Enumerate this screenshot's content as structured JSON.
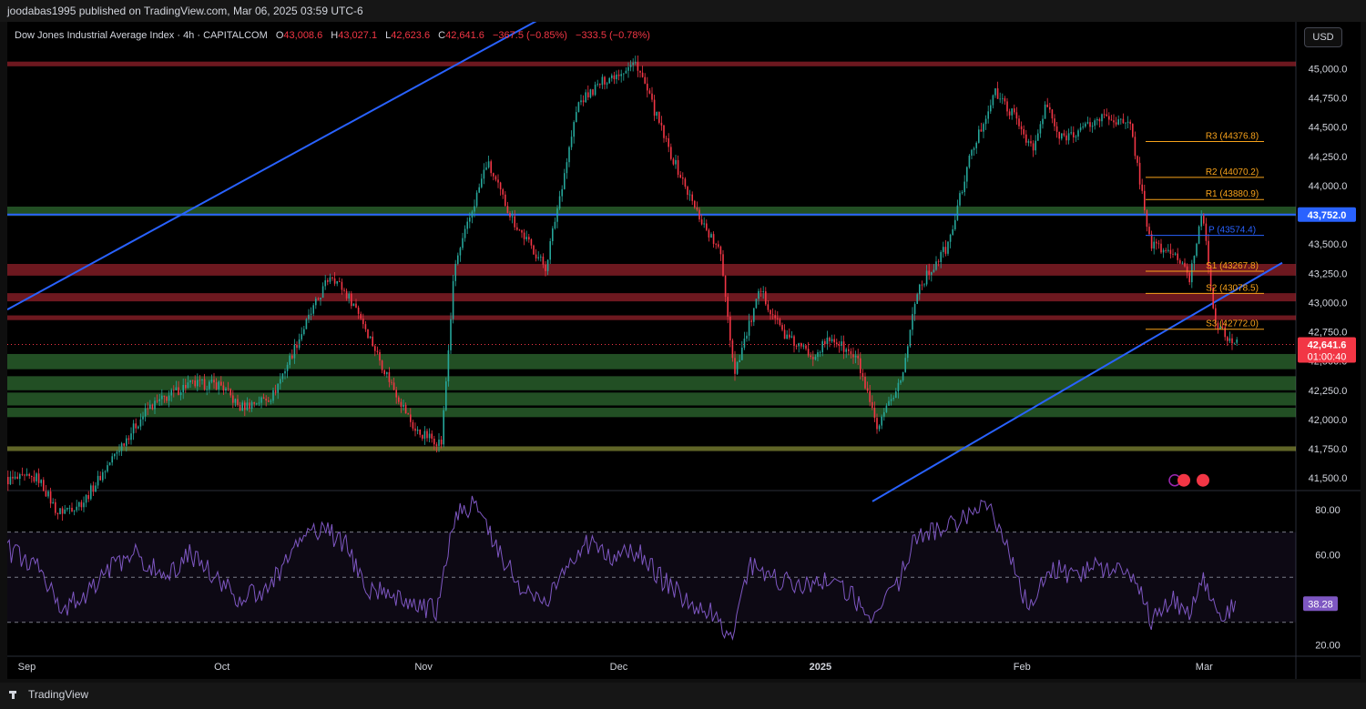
{
  "header": {
    "publisher": "joodabas1995 published on TradingView.com, Mar 06, 2025 03:59 UTC-6"
  },
  "legend": {
    "symbol": "Dow Jones Industrial Average Index · 4h · CAPITALCOM",
    "o_label": "O",
    "o_value": "43,008.6",
    "h_label": "H",
    "h_value": "43,027.1",
    "l_label": "L",
    "l_value": "42,623.6",
    "c_label": "C",
    "c_value": "42,641.6",
    "change": "−367.5 (−0.85%)",
    "change2": "−333.5 (−0.78%)"
  },
  "currency_button": "USD",
  "footer": {
    "brand": "TradingView"
  },
  "colors": {
    "background": "#000000",
    "bull": "#26a69a",
    "bear": "#f23645",
    "trendline": "#2962ff",
    "pivot_orange": "#f7a21b",
    "pivot_blue": "#2962ff",
    "rsi": "#7e57c2",
    "support_zone": "#4caf50",
    "resistance_zone": "#f23645",
    "major_support": "#d4e157"
  },
  "chart_data": [
    {
      "type": "candlestick",
      "title": "Dow Jones Industrial Average Index · 4h · CAPITALCOM",
      "x_ticks": [
        "Sep",
        "Oct",
        "Nov",
        "Dec",
        "2025",
        "Feb",
        "Mar"
      ],
      "ylim": [
        41400,
        45400
      ],
      "y_ticks": [
        "45,000.0",
        "44,750.0",
        "44,500.0",
        "44,250.0",
        "44,000.0",
        "43,750.0",
        "43,500.0",
        "43,250.0",
        "43,000.0",
        "42,750.0",
        "42,500.0",
        "42,250.0",
        "42,000.0",
        "41,750.0",
        "41,500.0"
      ],
      "y_tick_values": [
        45000,
        44750,
        44500,
        44250,
        44000,
        43750,
        43500,
        43250,
        43000,
        42750,
        42500,
        42250,
        42000,
        41750,
        41500
      ],
      "price_path": [
        [
          "Aug 29",
          41480
        ],
        [
          "Sep 3",
          41500
        ],
        [
          "Sep 6",
          41200
        ],
        [
          "Sep 10",
          41300
        ],
        [
          "Sep 16",
          41800
        ],
        [
          "Sep 20",
          42100
        ],
        [
          "Sep 26",
          42300
        ],
        [
          "Oct 1",
          42300
        ],
        [
          "Oct 4",
          42100
        ],
        [
          "Oct 9",
          42200
        ],
        [
          "Oct 14",
          42800
        ],
        [
          "Oct 18",
          43250
        ],
        [
          "Oct 22",
          42950
        ],
        [
          "Oct 26",
          42450
        ],
        [
          "Oct 31",
          41900
        ],
        [
          "Nov 4",
          41800
        ],
        [
          "Nov 6",
          43300
        ],
        [
          "Nov 11",
          44200
        ],
        [
          "Nov 15",
          43700
        ],
        [
          "Nov 20",
          43300
        ],
        [
          "Nov 25",
          44700
        ],
        [
          "Nov 29",
          44900
        ],
        [
          "Dec 4",
          45050
        ],
        [
          "Dec 9",
          44300
        ],
        [
          "Dec 13",
          43800
        ],
        [
          "Dec 17",
          43400
        ],
        [
          "Dec 19",
          42400
        ],
        [
          "Dec 23",
          43100
        ],
        [
          "Dec 27",
          42700
        ],
        [
          "Dec 31",
          42550
        ],
        [
          "Jan 3",
          42700
        ],
        [
          "Jan 7",
          42500
        ],
        [
          "Jan 10",
          41900
        ],
        [
          "Jan 14",
          42400
        ],
        [
          "Jan 16",
          43100
        ],
        [
          "Jan 21",
          43500
        ],
        [
          "Jan 24",
          44200
        ],
        [
          "Jan 28",
          44800
        ],
        [
          "Jan 31",
          44600
        ],
        [
          "Feb 3",
          44300
        ],
        [
          "Feb 5",
          44700
        ],
        [
          "Feb 7",
          44400
        ],
        [
          "Feb 11",
          44500
        ],
        [
          "Feb 14",
          44600
        ],
        [
          "Feb 18",
          44500
        ],
        [
          "Feb 21",
          43500
        ],
        [
          "Feb 25",
          43400
        ],
        [
          "Feb 27",
          43200
        ],
        [
          "Mar 1",
          43800
        ],
        [
          "Mar 3",
          42800
        ],
        [
          "Mar 5",
          42700
        ],
        [
          "Mar 6",
          42641.6
        ]
      ],
      "last_price": {
        "value": 42641.6,
        "label": "42,641.6",
        "countdown": "01:00:40"
      },
      "trendlines": [
        {
          "name": "upper-channel-line",
          "points": [
            [
              "Aug 29",
              42940
            ],
            [
              "Nov 28",
              45700
            ]
          ]
        },
        {
          "name": "lower-channel-line",
          "points": [
            [
              "Jan 9",
              41300
            ],
            [
              "Mar 13",
              43340
            ]
          ]
        }
      ],
      "horizontal_lines": [
        {
          "name": "blue-level",
          "value": 43752.0,
          "label": "43,752.0",
          "color": "#2962ff"
        }
      ],
      "zones": [
        {
          "name": "resistance-zone-top",
          "low": 45020,
          "high": 45060,
          "color": "#f23645"
        },
        {
          "name": "green-zone-43750",
          "low": 43740,
          "high": 43820,
          "color": "#4caf50"
        },
        {
          "name": "red-zone-43300",
          "low": 43230,
          "high": 43330,
          "color": "#f23645"
        },
        {
          "name": "red-zone-43050",
          "low": 43010,
          "high": 43080,
          "color": "#f23645"
        },
        {
          "name": "red-zone-42870",
          "low": 42850,
          "high": 42890,
          "color": "#f23645"
        },
        {
          "name": "green-zone-42500",
          "low": 42430,
          "high": 42560,
          "color": "#4caf50"
        },
        {
          "name": "green-zone-42300",
          "low": 42250,
          "high": 42370,
          "color": "#4caf50"
        },
        {
          "name": "green-zone-42150",
          "low": 42120,
          "high": 42230,
          "color": "#4caf50"
        },
        {
          "name": "green-zone-42050",
          "low": 42020,
          "high": 42100,
          "color": "#4caf50"
        },
        {
          "name": "major-support-41750",
          "low": 41730,
          "high": 41770,
          "color": "#d4e157"
        }
      ],
      "pivots": [
        {
          "label": "R3 (44376.8)",
          "value": 44376.8,
          "color": "#f7a21b"
        },
        {
          "label": "R2 (44070.2)",
          "value": 44070.2,
          "color": "#f7a21b"
        },
        {
          "label": "R1 (43880.9)",
          "value": 43880.9,
          "color": "#f7a21b"
        },
        {
          "label": "P (43574.4)",
          "value": 43574.4,
          "color": "#2962ff"
        },
        {
          "label": "S1 (43267.8)",
          "value": 43267.8,
          "color": "#f7a21b"
        },
        {
          "label": "S2 (43078.5)",
          "value": 43078.5,
          "color": "#f7a21b"
        },
        {
          "label": "S3 (42772.0)",
          "value": 42772.0,
          "color": "#f7a21b"
        }
      ]
    },
    {
      "type": "line",
      "ylim": [
        15,
        88
      ],
      "y_ticks": [
        "80.00",
        "60.00",
        "20.00"
      ],
      "y_tick_values": [
        80,
        60,
        20
      ],
      "levels": [
        70,
        50,
        30
      ],
      "last_value": {
        "value": 38.28,
        "label": "38.28"
      },
      "path": [
        [
          "Aug 29",
          62
        ],
        [
          "Sep 3",
          55
        ],
        [
          "Sep 6",
          35
        ],
        [
          "Sep 10",
          42
        ],
        [
          "Sep 14",
          55
        ],
        [
          "Sep 18",
          60
        ],
        [
          "Sep 22",
          50
        ],
        [
          "Sep 26",
          60
        ],
        [
          "Oct 1",
          48
        ],
        [
          "Oct 4",
          40
        ],
        [
          "Oct 8",
          45
        ],
        [
          "Oct 12",
          62
        ],
        [
          "Oct 16",
          72
        ],
        [
          "Oct 20",
          65
        ],
        [
          "Oct 23",
          45
        ],
        [
          "Oct 27",
          42
        ],
        [
          "Oct 31",
          38
        ],
        [
          "Nov 3",
          35
        ],
        [
          "Nov 6",
          80
        ],
        [
          "Nov 9",
          82
        ],
        [
          "Nov 12",
          65
        ],
        [
          "Nov 16",
          45
        ],
        [
          "Nov 20",
          40
        ],
        [
          "Nov 23",
          55
        ],
        [
          "Nov 26",
          65
        ],
        [
          "Nov 30",
          60
        ],
        [
          "Dec 4",
          62
        ],
        [
          "Dec 8",
          48
        ],
        [
          "Dec 12",
          38
        ],
        [
          "Dec 15",
          35
        ],
        [
          "Dec 18",
          22
        ],
        [
          "Dec 21",
          55
        ],
        [
          "Dec 25",
          50
        ],
        [
          "Dec 29",
          45
        ],
        [
          "Jan 2",
          50
        ],
        [
          "Jan 6",
          42
        ],
        [
          "Jan 9",
          30
        ],
        [
          "Jan 13",
          48
        ],
        [
          "Jan 16",
          70
        ],
        [
          "Jan 20",
          72
        ],
        [
          "Jan 24",
          78
        ],
        [
          "Jan 27",
          80
        ],
        [
          "Jan 30",
          62
        ],
        [
          "Feb 2",
          35
        ],
        [
          "Feb 5",
          55
        ],
        [
          "Feb 9",
          50
        ],
        [
          "Feb 13",
          55
        ],
        [
          "Feb 16",
          52
        ],
        [
          "Feb 19",
          45
        ],
        [
          "Feb 21",
          30
        ],
        [
          "Feb 24",
          40
        ],
        [
          "Feb 27",
          35
        ],
        [
          "Mar 1",
          50
        ],
        [
          "Mar 3",
          33
        ],
        [
          "Mar 6",
          38.28
        ]
      ]
    }
  ]
}
